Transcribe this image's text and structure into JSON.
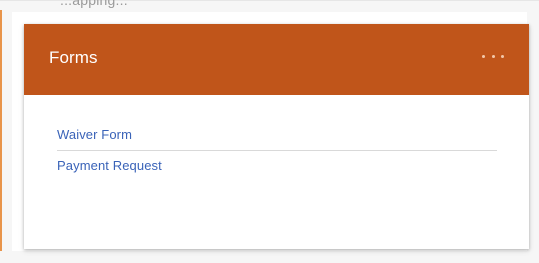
{
  "page": {
    "top_cutoff_text": "...apping..."
  },
  "card": {
    "title": "Forms",
    "header_color": "#c0551a",
    "more_icon": "more-horizontal-icon",
    "links": [
      {
        "label": "Waiver Form"
      },
      {
        "label": "Payment Request"
      }
    ]
  }
}
